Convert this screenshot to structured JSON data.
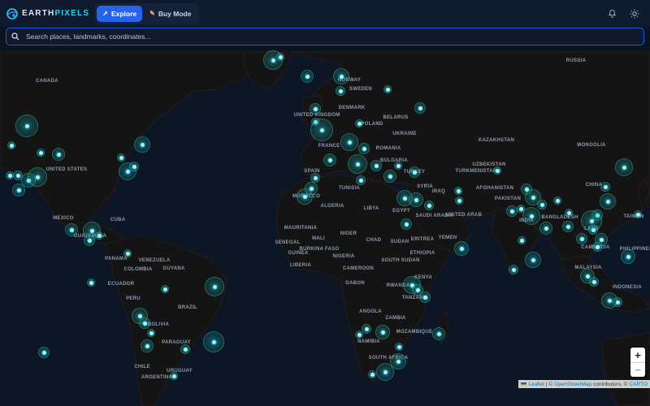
{
  "header": {
    "logo_left": "EARTH",
    "logo_right": "PIXELS",
    "modes": [
      {
        "label": "Explore",
        "active": true,
        "icon": "cursor-icon"
      },
      {
        "label": "Buy Mode",
        "active": false,
        "icon": "pencil-icon"
      }
    ]
  },
  "search": {
    "placeholder": "Search places, landmarks, coordinates..."
  },
  "map_labels": [
    "RUSSIA",
    "CANADA",
    "UNITED STATES",
    "MEXICO",
    "CUBA",
    "GUATEMALA",
    "VENEZUELA",
    "PANAMA",
    "COLOMBIA",
    "GUYANA",
    "ECUADOR",
    "PERU",
    "BRAZIL",
    "BOLIVIA",
    "PARAGUAY",
    "CHILE",
    "URUGUAY",
    "ARGENTINA",
    "NORWAY",
    "SWEDEN",
    "UNITED KINGDOM",
    "DENMARK",
    "BELARUS",
    "POLAND",
    "UKRAINE",
    "FRANCE",
    "ROMANIA",
    "BULGARIA",
    "SPAIN",
    "TURKEY",
    "MOROCCO",
    "TUNISIA",
    "ALGERIA",
    "LIBYA",
    "EGYPT",
    "MAURITANIA",
    "MALI",
    "NIGER",
    "CHAD",
    "SUDAN",
    "SENEGAL",
    "BURKINA FASO",
    "GUINEA",
    "LIBERIA",
    "NIGERIA",
    "CAMEROON",
    "GABON",
    "ERITREA",
    "YEMEN",
    "ETHIOPIA",
    "SOUTH SUDAN",
    "KENYA",
    "RWANDA",
    "TANZANIA",
    "ANGOLA",
    "ZAMBIA",
    "MOZAMBIQUE",
    "NAMIBIA",
    "SOUTH AFRICA",
    "SYRIA",
    "IRAQ",
    "SAUDI ARABIA",
    "UNITED ARAB",
    "KAZAKHSTAN",
    "UZBEKISTAN",
    "TURKMENISTAN",
    "AFGHANISTAN",
    "PAKISTAN",
    "INDIA",
    "BANGLADESH",
    "LAOS",
    "CAMBODIA",
    "MONGOLIA",
    "CHINA",
    "TAIWAN",
    "PHILIPPINES",
    "MALAYSIA",
    "INDONESIA"
  ],
  "zoom": {
    "in": "+",
    "out": "−"
  },
  "attribution": {
    "leaflet": "Leaflet",
    "sep1": "| ©",
    "osm": "OpenStreetMap",
    "contrib": "contributors, ©",
    "carto": "CARTO"
  },
  "colors": {
    "accent": "#22d3ee",
    "active_mode": "#2563eb",
    "background": "#0b1220"
  }
}
